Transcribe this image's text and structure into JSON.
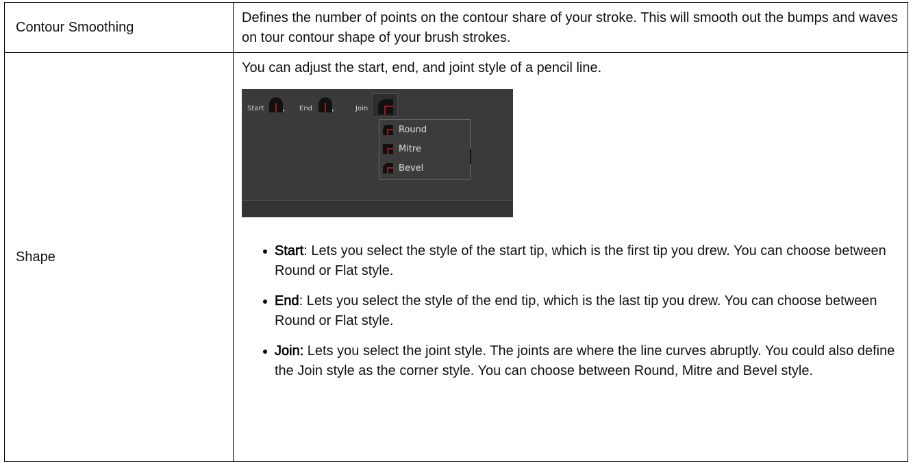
{
  "rows": [
    {
      "label": "Contour Smoothing",
      "description": "Defines the number of points on the contour share of your stroke. This will smooth out the bumps and waves on tour contour shape of your brush strokes."
    },
    {
      "label": "Shape",
      "intro": "You can adjust the start, end, and joint style of a pencil line.",
      "panel": {
        "start_label": "Start",
        "end_label": "End",
        "join_label": "Join",
        "menu_items": [
          "Round",
          "Mitre",
          "Bevel"
        ],
        "accent_color": "#d01c1c"
      },
      "bullets": [
        {
          "term": "Start",
          "sep": ":",
          "text": " Lets you select the style of the start tip, which is the first tip you drew. You can choose between Round or Flat style."
        },
        {
          "term": "End",
          "sep": ":",
          "text": " Lets you select the style of the end tip, which is the last tip you drew. You can choose between Round or Flat style."
        },
        {
          "term": "Join:",
          "sep": "",
          "text": " Lets you select the joint style. The joints are where the line curves abruptly. You could also define the Join style as the corner style. You can choose between Round, Mitre and Bevel style."
        }
      ]
    }
  ]
}
